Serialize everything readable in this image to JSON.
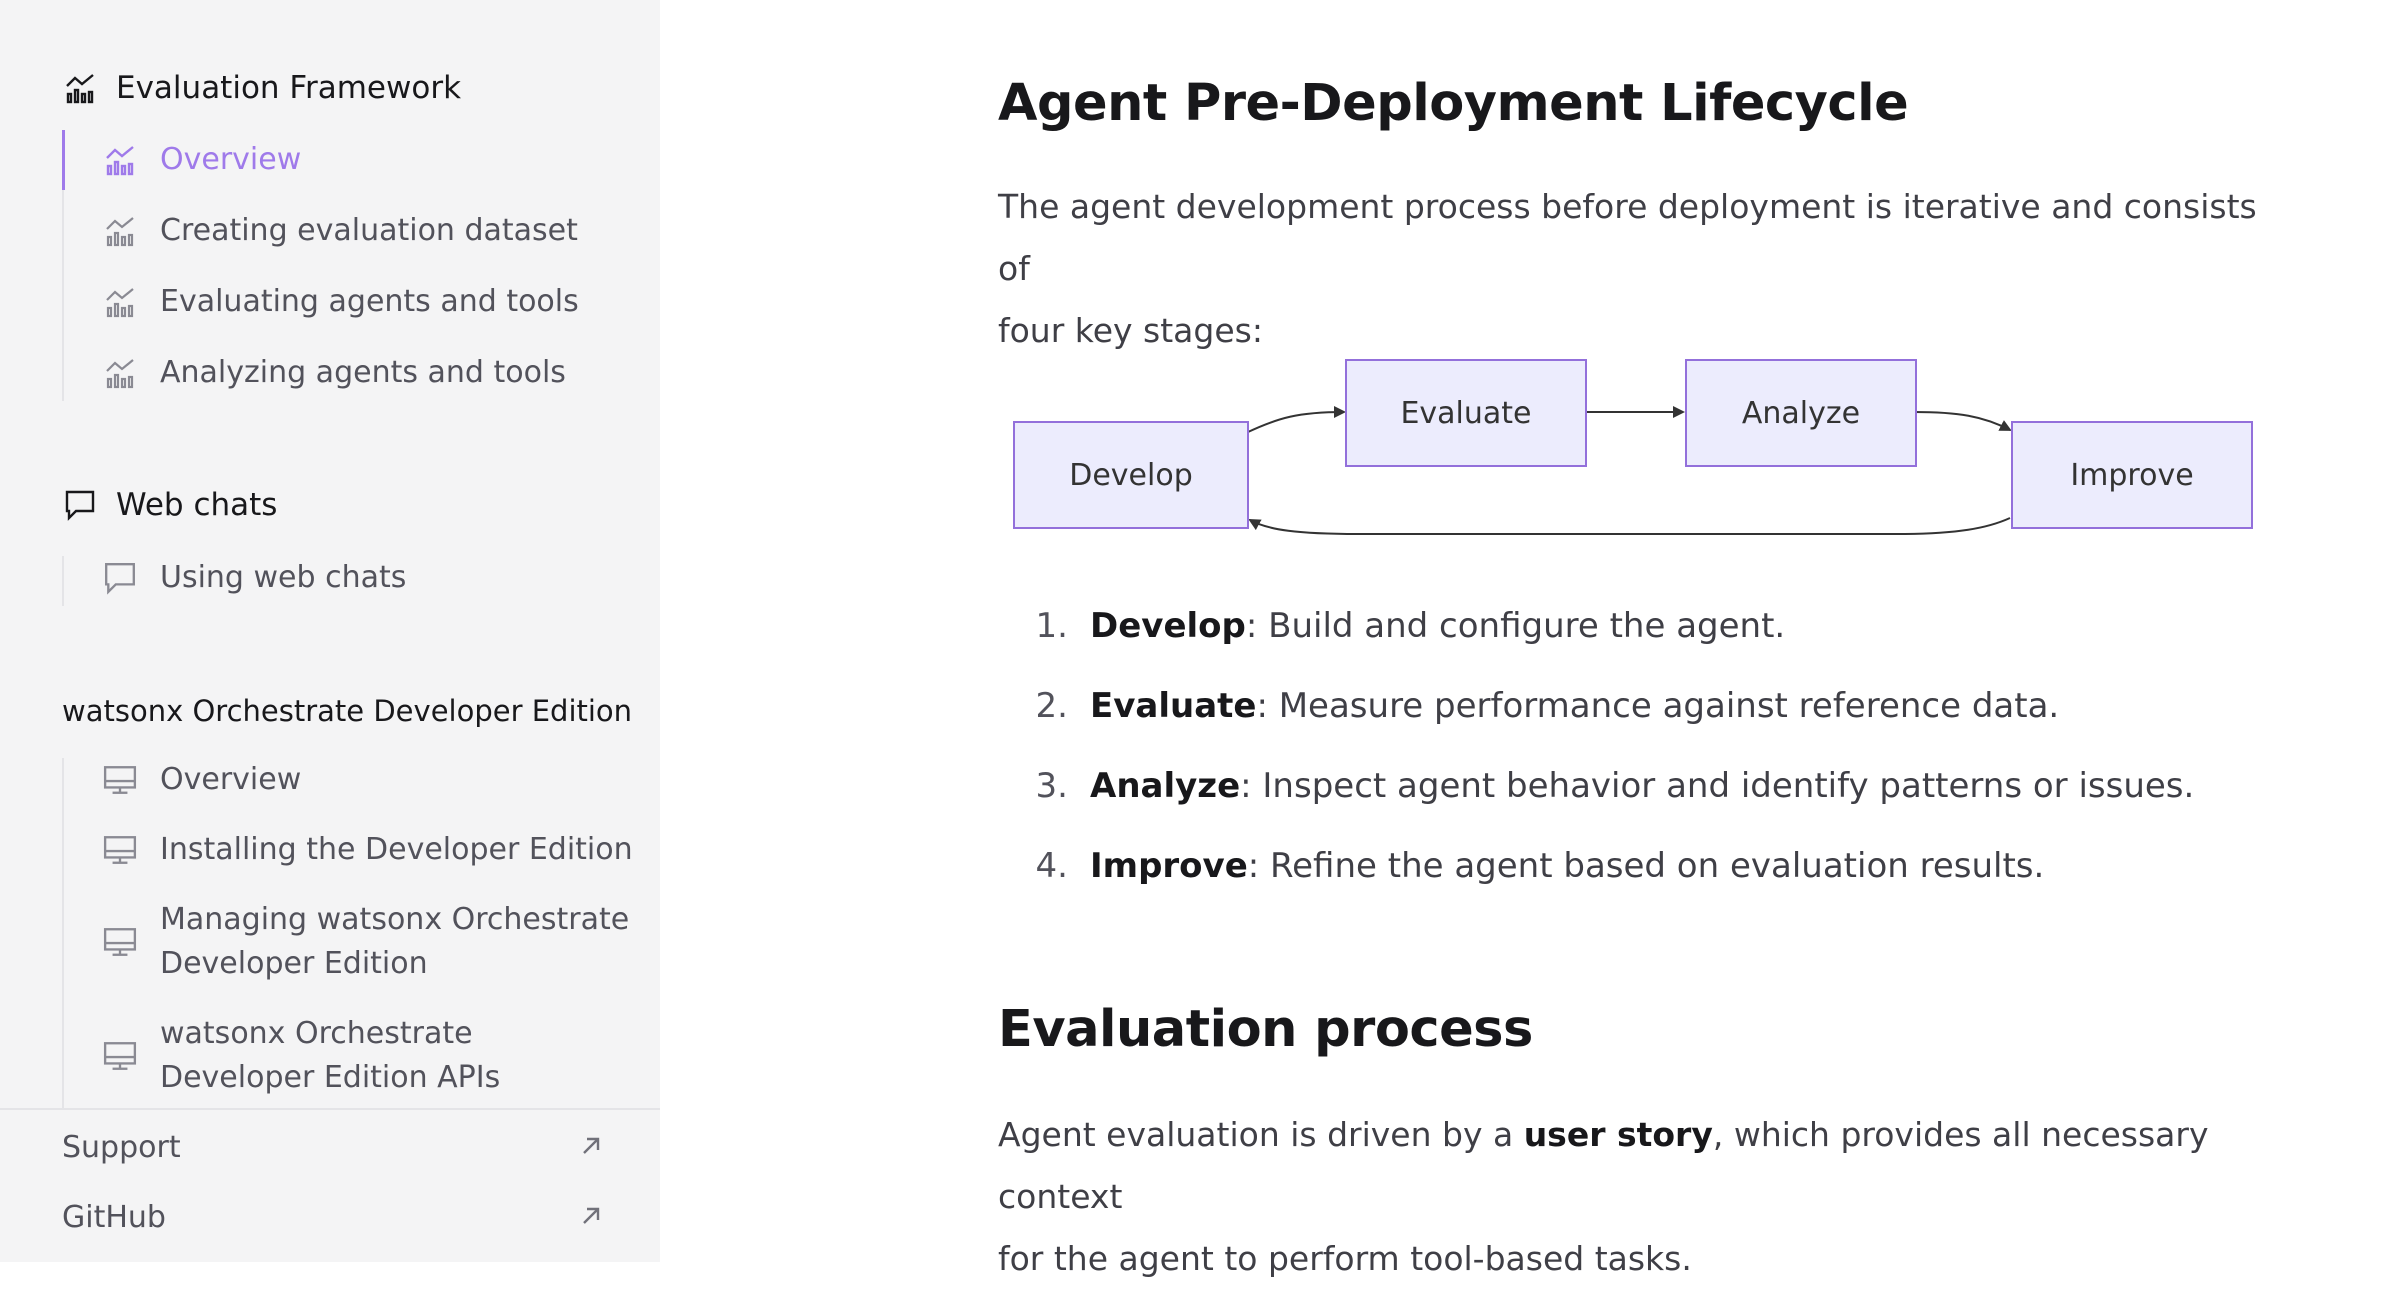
{
  "sidebar": {
    "eval_group": {
      "title": "Evaluation Framework",
      "items": [
        {
          "label": "Overview",
          "active": true
        },
        {
          "label": "Creating evaluation dataset"
        },
        {
          "label": "Evaluating agents and tools"
        },
        {
          "label": "Analyzing agents and tools"
        }
      ]
    },
    "webchat_group": {
      "title": "Web chats",
      "items": [
        {
          "label": "Using web chats"
        }
      ]
    },
    "devedition_group": {
      "title": "watsonx Orchestrate Developer Edition",
      "items": [
        {
          "label": "Overview"
        },
        {
          "label": "Installing the Developer Edition"
        },
        {
          "label": "Managing watsonx Orchestrate",
          "label2": "Developer Edition"
        },
        {
          "label": "watsonx Orchestrate",
          "label2": "Developer Edition APIs",
          "expandable": true
        }
      ]
    },
    "footer": {
      "support": "Support",
      "github": "GitHub"
    }
  },
  "main": {
    "section1": {
      "heading": "Agent Pre-Deployment Lifecycle",
      "intro_line1": "The agent development process before deployment is iterative and consists of",
      "intro_line2": "four key stages:"
    },
    "diagram": {
      "nodes": [
        "Develop",
        "Evaluate",
        "Analyze",
        "Improve"
      ],
      "fill": "#ececfd",
      "stroke": "#9370db"
    },
    "steps": [
      {
        "num": "1.",
        "term": "Develop",
        "desc": ": Build and configure the agent."
      },
      {
        "num": "2.",
        "term": "Evaluate",
        "desc": ": Measure performance against reference data."
      },
      {
        "num": "3.",
        "term": "Analyze",
        "desc": ": Inspect agent behavior and identify patterns or issues."
      },
      {
        "num": "4.",
        "term": "Improve",
        "desc": ": Refine the agent based on evaluation results."
      }
    ],
    "section2": {
      "heading": "Evaluation process",
      "p1_before": "Agent evaluation is driven by a ",
      "p1_bold": "user story",
      "p1_after": ", which provides all necessary context",
      "p1_line2": "for the agent to perform tool-based tasks."
    }
  },
  "colors": {
    "accent": "#9f7aea",
    "sidebar_bg": "#f4f4f5",
    "heading": "#18181b",
    "text": "#3f3f46"
  }
}
